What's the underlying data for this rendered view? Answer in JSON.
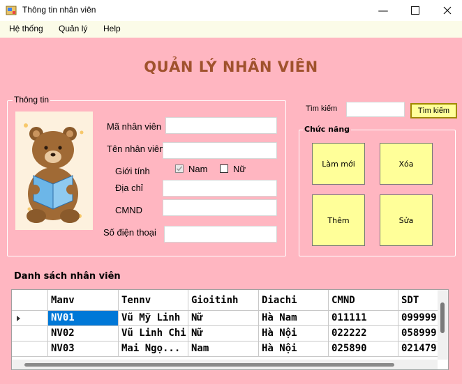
{
  "window": {
    "title": "Thông tin nhân viên"
  },
  "menu": [
    "Hệ thống",
    "Quản lý",
    "Help"
  ],
  "main_title": "QUẢN LÝ NHÂN VIÊN",
  "info_group": {
    "legend": "Thông tin",
    "labels": {
      "ma": "Mã nhân viên",
      "ten": "Tên nhân viên",
      "gioitinh": "Giới tính",
      "diachi": "Địa chỉ",
      "cmnd": "CMND",
      "sdt": "Số điện thoại"
    },
    "values": {
      "ma": "",
      "ten": "",
      "diachi": "",
      "cmnd": "",
      "sdt": ""
    },
    "gender": {
      "nam": "Nam",
      "nu": "Nữ",
      "nam_checked": true,
      "nu_checked": false
    }
  },
  "search": {
    "label": "Tìm kiếm",
    "value": "",
    "button": "Tìm kiếm"
  },
  "func_group": {
    "legend": "Chức năng",
    "buttons": [
      "Làm mới",
      "Xóa",
      "Thêm",
      "Sửa"
    ]
  },
  "list": {
    "title": "Danh sách nhân viên",
    "columns": [
      "Manv",
      "Tennv",
      "Gioitinh",
      "Diachi",
      "CMND",
      "SDT"
    ],
    "rows": [
      [
        "NV01",
        "Vũ Mỹ Linh",
        "Nữ",
        "Hà Nam",
        "011111",
        "099999"
      ],
      [
        "NV02",
        "Vũ Linh Chi",
        "Nữ",
        "Hà Nội",
        "022222",
        "058999"
      ],
      [
        "NV03",
        "Mai Ngọ...",
        "Nam",
        "Hà Nội",
        "025890",
        "021479"
      ]
    ]
  }
}
